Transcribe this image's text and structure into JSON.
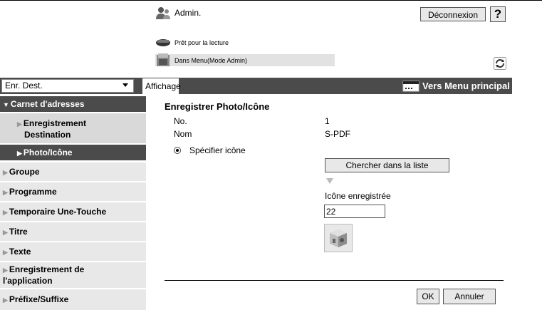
{
  "header": {
    "user_label": "Admin.",
    "user_icon": "admin-user-icon",
    "logout_label": "Déconnexion",
    "help_label": "?",
    "status_ready": "Prêt pour la lecture",
    "status_mode": "Dans Menu(Mode Admin)",
    "refresh_icon": "refresh-icon"
  },
  "toolbar": {
    "dest_select_value": "Enr. Dest.",
    "tab_label": "Affichage",
    "main_menu_label": "Vers Menu principal"
  },
  "sidebar": {
    "section": "Carnet d'adresses",
    "sub_items": [
      "Enregistrement Destination",
      "Photo/Icône"
    ],
    "items": [
      "Groupe",
      "Programme",
      "Temporaire Une-Touche",
      "Titre",
      "Texte",
      "Enregistrement de l'application",
      "Préfixe/Suffixe"
    ]
  },
  "main": {
    "title": "Enregistrer Photo/Icône",
    "no_label": "No.",
    "no_value": "1",
    "name_label": "Nom",
    "name_value": "S-PDF",
    "radio_label": "Spécifier icône",
    "search_button": "Chercher dans la liste",
    "registered_icon_label": "Icône enregistrée",
    "registered_icon_value": "22",
    "ok_label": "OK",
    "cancel_label": "Annuler"
  },
  "colors": {
    "dark_bar": "#4b4b4b",
    "light_panel": "#e8e8e8",
    "sub_panel": "#d9d9d9"
  }
}
